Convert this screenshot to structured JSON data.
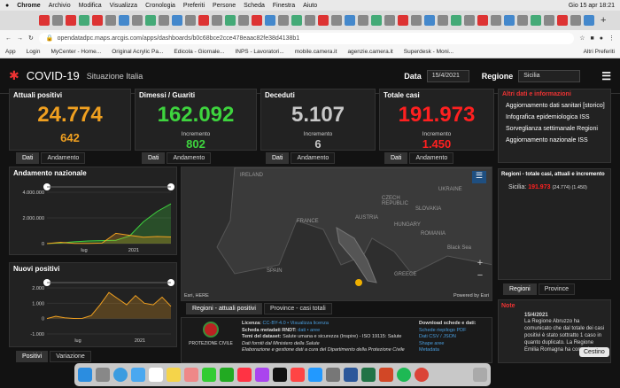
{
  "mac": {
    "apple": "",
    "app": "Chrome",
    "menus": [
      "Archivio",
      "Modifica",
      "Visualizza",
      "Cronologia",
      "Preferiti",
      "Persone",
      "Scheda",
      "Finestra",
      "Aiuto"
    ],
    "clock": "Gio 15 apr 18:21"
  },
  "browser": {
    "url": "opendatadpc.maps.arcgis.com/apps/dashboards/b0c68bce2cce478eaac82fe38d4138b1",
    "bookmarks": [
      "App",
      "Login",
      "MyCenter - Home...",
      "Original Acrylic Pa...",
      "Edicola - Giornale...",
      "INPS - Lavoratori...",
      "mobile.camera.it",
      "agenzie.camera.it",
      "Superdesk - Moni..."
    ],
    "other": "Altri Preferiti"
  },
  "header": {
    "title": "COVID-19",
    "subtitle": "Situazione Italia",
    "date_label": "Data",
    "date_value": "15/4/2021",
    "region_label": "Regione",
    "region_value": "Sicilia"
  },
  "kpis": [
    {
      "title": "Attuali positivi",
      "value": "24.774",
      "inc_label": "",
      "inc": "642",
      "color": "#f0a020"
    },
    {
      "title": "Dimessi / Guariti",
      "value": "162.092",
      "inc_label": "Incremento",
      "inc": "802",
      "color": "#3ed43e"
    },
    {
      "title": "Deceduti",
      "value": "5.107",
      "inc_label": "Incremento",
      "inc": "6",
      "color": "#c8c8c8"
    },
    {
      "title": "Totale casi",
      "value": "191.973",
      "inc_label": "Incremento",
      "inc": "1.450",
      "color": "#ff2020"
    }
  ],
  "tabs": {
    "dati": "Dati",
    "andamento": "Andamento",
    "positivi": "Positivi",
    "variazione": "Variazione",
    "regioni_map": "Regioni - attuali positivi",
    "province_map": "Province - casi totali",
    "regioni": "Regioni",
    "province": "Province"
  },
  "charts": {
    "andamento_title": "Andamento nazionale",
    "nuovi_title": "Nuovi positivi"
  },
  "links": {
    "title": "Altri dati e informazioni",
    "items": [
      "Aggiornamento dati sanitari [storico]",
      "Infografica epidemiologica ISS",
      "Sorveglianza settimanale Regioni",
      "Aggiornamento nazionale ISS"
    ]
  },
  "regioni_panel": {
    "title": "Regioni - totale casi, attuali e incremento",
    "line_region": "Sicilia:",
    "line_total": "191.973",
    "line_rest": "(24.774) (1.450)"
  },
  "map": {
    "countries": [
      "IRELAND",
      "CZECH REPUBLIC",
      "SLOVAKIA",
      "UKRAINE",
      "FRANCE",
      "AUSTRIA",
      "HUNGARY",
      "ROMANIA",
      "SPAIN",
      "GREECE"
    ],
    "sea": "Black Sea",
    "credit": "Esri, HERE",
    "powered": "Powered by Esri"
  },
  "footer": {
    "org": "PROTEZIONE CIVILE",
    "licenza_label": "Licenza:",
    "licenza": "CC-BY-4.0 • Visualizza licenza",
    "rndt_label": "Scheda metadati RNDT:",
    "rndt": "dati • aree",
    "temi_label": "Temi del dataset:",
    "temi": "Salute umana e sicurezza (Inspire) - ISO 19115: Salute",
    "fonte": "Dati forniti dal Ministero della Salute",
    "elab": "Elaborazione e gestione dati a cura del Dipartimento della Protezione Civile",
    "dl_title": "Download schede e dati:",
    "dl": [
      "Schede riepilogo PDF",
      "Dati CSV / JSON",
      "Shape aree",
      "Metadata"
    ]
  },
  "note": {
    "title": "Note",
    "date": "15/4/2021",
    "text": "La Regione Abruzzo ha comunicato che dal totale dei casi positivi è stato sottratto 1 caso in quanto duplicato. La Regione Emilia Romagna ha comunicato"
  },
  "tooltip": "Cestino",
  "chart_data": [
    {
      "type": "line",
      "title": "Andamento nazionale",
      "x": [
        "",
        "lug",
        "",
        "2021",
        ""
      ],
      "yticks": [
        "0",
        "2.000.000",
        "4.000.000"
      ],
      "ylim": [
        0,
        4000000
      ],
      "series": [
        {
          "name": "",
          "color": "#3ed43e",
          "values": [
            0,
            50000,
            150000,
            210000,
            230000,
            260000,
            600000,
            1700000,
            2500000,
            3100000
          ]
        },
        {
          "name": "",
          "color": "#f0a020",
          "values": [
            0,
            100000,
            20000,
            15000,
            40000,
            800000,
            650000,
            500000,
            550000,
            520000
          ]
        }
      ]
    },
    {
      "type": "line",
      "title": "Nuovi positivi",
      "x": [
        "lug",
        "2021"
      ],
      "yticks": [
        "-1.000",
        "0",
        "1.000",
        "2.000"
      ],
      "ylim": [
        -1000,
        2000
      ],
      "series": [
        {
          "name": "",
          "color": "#f0a020",
          "values": [
            0,
            150,
            50,
            10,
            20,
            200,
            900,
            1700,
            1300,
            900,
            1500,
            1000,
            900,
            1400,
            800
          ]
        }
      ]
    }
  ]
}
